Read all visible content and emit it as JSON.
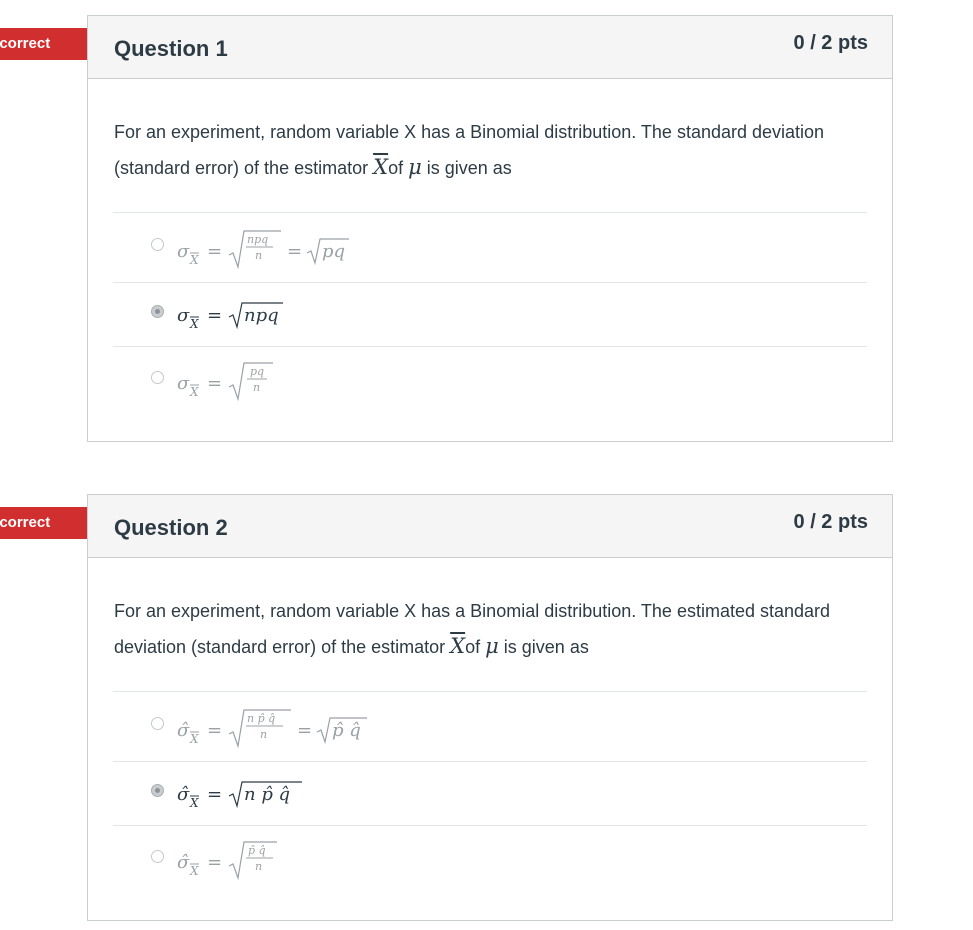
{
  "questions": [
    {
      "status": "Incorrect",
      "title": "Question 1",
      "points": "0 / 2 pts",
      "text_before": "For an experiment, random variable X has a Binomial distribution. The standard deviation (standard error) of the estimator ",
      "estimator": "X",
      "text_mid": "of ",
      "param": "μ",
      "text_after": " is given as",
      "answers": [
        {
          "label": "σ_X̄ = √(npq/n) = √pq",
          "selected": false
        },
        {
          "label": "σ_X̄ = √npq",
          "selected": true
        },
        {
          "label": "σ_X̄ = √(pq/n)",
          "selected": false
        }
      ]
    },
    {
      "status": "Incorrect",
      "title": "Question 2",
      "points": "0 / 2 pts",
      "text_before": "For an experiment, random variable X has a Binomial distribution. The estimated standard deviation (standard error) of the estimator ",
      "estimator": "X",
      "text_mid": "of ",
      "param": "μ",
      "text_after": " is given as",
      "answers": [
        {
          "label": "σ̂_X̄ = √(n p̂ q̂ / n) = √(p̂ q̂)",
          "selected": false
        },
        {
          "label": "σ̂_X̄ = √(n p̂ q̂)",
          "selected": true
        },
        {
          "label": "σ̂_X̄ = √(p̂ q̂ / n)",
          "selected": false
        }
      ]
    }
  ],
  "colors": {
    "badge": "#d12f2f",
    "border": "#c7cdd1",
    "header_bg": "#f5f5f5",
    "text": "#2d3b45"
  }
}
